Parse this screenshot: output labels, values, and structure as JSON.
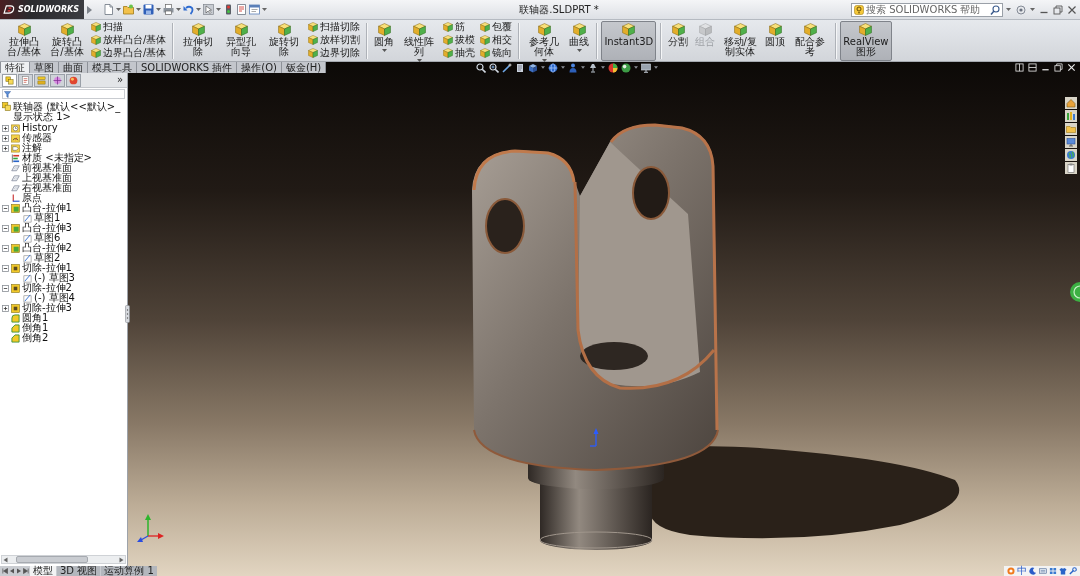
{
  "title_bar": {
    "logo_text": "SOLIDWORKS",
    "title": "联轴器.SLDPRT *",
    "search": {
      "placeholder": "搜索 SOLIDWORKS 帮助"
    }
  },
  "ribbon": {
    "groups": [
      {
        "items": [
          {
            "kind": "large",
            "label": "拉伸凸台/基体",
            "dropdown": false,
            "active": false,
            "disabled": false
          },
          {
            "kind": "large",
            "label": "旋转凸台/基体",
            "dropdown": false,
            "active": false,
            "disabled": false
          },
          {
            "kind": "stack",
            "items": [
              {
                "label": "扫描"
              },
              {
                "label": "放样凸台/基体"
              },
              {
                "label": "边界凸台/基体"
              }
            ]
          }
        ]
      },
      {
        "items": [
          {
            "kind": "large",
            "label": "拉伸切除",
            "dropdown": false,
            "active": false,
            "disabled": false
          },
          {
            "kind": "large",
            "label": "异型孔向导",
            "dropdown": false,
            "active": false,
            "disabled": false
          },
          {
            "kind": "large",
            "label": "旋转切除",
            "dropdown": false,
            "active": false,
            "disabled": false
          },
          {
            "kind": "stack",
            "items": [
              {
                "label": "扫描切除"
              },
              {
                "label": "放样切割"
              },
              {
                "label": "边界切除"
              }
            ]
          }
        ]
      },
      {
        "items": [
          {
            "kind": "large",
            "label": "圆角",
            "dropdown": true,
            "active": false,
            "disabled": false
          },
          {
            "kind": "large",
            "label": "线性阵列",
            "dropdown": true,
            "active": false,
            "disabled": false
          },
          {
            "kind": "stack",
            "items": [
              {
                "label": "筋"
              },
              {
                "label": "拔模"
              },
              {
                "label": "抽壳"
              }
            ]
          },
          {
            "kind": "stack",
            "items": [
              {
                "label": "包覆"
              },
              {
                "label": "相交"
              },
              {
                "label": "镜向"
              }
            ]
          }
        ]
      },
      {
        "items": [
          {
            "kind": "large",
            "label": "参考几何体",
            "dropdown": true,
            "active": false,
            "disabled": false
          },
          {
            "kind": "large",
            "label": "曲线",
            "dropdown": true,
            "active": false,
            "disabled": false
          }
        ]
      },
      {
        "items": [
          {
            "kind": "large",
            "label": "Instant3D",
            "dropdown": false,
            "active": true,
            "disabled": false
          }
        ]
      },
      {
        "items": [
          {
            "kind": "large",
            "label": "分割",
            "dropdown": false,
            "active": false,
            "disabled": false
          },
          {
            "kind": "large",
            "label": "组合",
            "dropdown": false,
            "active": false,
            "disabled": true
          },
          {
            "kind": "large",
            "label": "移动/复制实体",
            "dropdown": false,
            "active": false,
            "disabled": false
          },
          {
            "kind": "large",
            "label": "圆顶",
            "dropdown": false,
            "active": false,
            "disabled": false
          },
          {
            "kind": "large",
            "label": "配合参考",
            "dropdown": false,
            "active": false,
            "disabled": false
          }
        ]
      },
      {
        "items": [
          {
            "kind": "large",
            "label": "RealView 图形",
            "dropdown": false,
            "active": true,
            "disabled": false
          }
        ]
      }
    ]
  },
  "tabs": [
    {
      "label": "特征",
      "selected": true
    },
    {
      "label": "草图",
      "selected": false
    },
    {
      "label": "曲面",
      "selected": false
    },
    {
      "label": "模具工具",
      "selected": false
    },
    {
      "label": "SOLIDWORKS 插件",
      "selected": false
    },
    {
      "label": "操作(O)",
      "selected": false
    },
    {
      "label": "钣金(H)",
      "selected": false
    }
  ],
  "feature_panel": {
    "tabs": [
      {
        "kind": "features",
        "selected": true
      },
      {
        "kind": "properties",
        "selected": false
      },
      {
        "kind": "configurations",
        "selected": false
      },
      {
        "kind": "dimxpert",
        "selected": false
      },
      {
        "kind": "display",
        "selected": false
      }
    ],
    "more": "»",
    "tree": {
      "root": "联轴器 (默认<<默认>_显示状态 1>",
      "items": [
        {
          "label": "History",
          "kind": "history",
          "expanded": false
        },
        {
          "label": "传感器",
          "kind": "sensor",
          "expanded": false
        },
        {
          "label": "注解",
          "kind": "annotation",
          "expanded": false
        },
        {
          "label": "材质 <未指定>",
          "kind": "material"
        },
        {
          "label": "前视基准面",
          "kind": "plane"
        },
        {
          "label": "上视基准面",
          "kind": "plane"
        },
        {
          "label": "右视基准面",
          "kind": "plane"
        },
        {
          "label": "原点",
          "kind": "origin"
        },
        {
          "label": "凸台-拉伸1",
          "kind": "boss",
          "expanded": true,
          "children": [
            {
              "label": "草图1",
              "kind": "sketch"
            }
          ]
        },
        {
          "label": "凸台-拉伸3",
          "kind": "boss",
          "expanded": true,
          "children": [
            {
              "label": "草图6",
              "kind": "sketch"
            }
          ]
        },
        {
          "label": "凸台-拉伸2",
          "kind": "boss",
          "expanded": true,
          "children": [
            {
              "label": "草图2",
              "kind": "sketch"
            }
          ]
        },
        {
          "label": "切除-拉伸1",
          "kind": "cut",
          "expanded": true,
          "children": [
            {
              "label": "(-) 草图3",
              "kind": "sketch"
            }
          ]
        },
        {
          "label": "切除-拉伸2",
          "kind": "cut",
          "expanded": true,
          "children": [
            {
              "label": "(-) 草图4",
              "kind": "sketch"
            }
          ]
        },
        {
          "label": "切除-拉伸3",
          "kind": "cut",
          "expanded": false
        },
        {
          "label": "圆角1",
          "kind": "fillet"
        },
        {
          "label": "倒角1",
          "kind": "chamfer"
        },
        {
          "label": "倒角2",
          "kind": "chamfer"
        }
      ]
    }
  },
  "bottom_tabs": [
    {
      "label": "模型",
      "selected": true
    },
    {
      "label": "3D 视图",
      "selected": false
    },
    {
      "label": "运动算例 1",
      "selected": false
    }
  ],
  "status_bar": {
    "ime": "中"
  }
}
